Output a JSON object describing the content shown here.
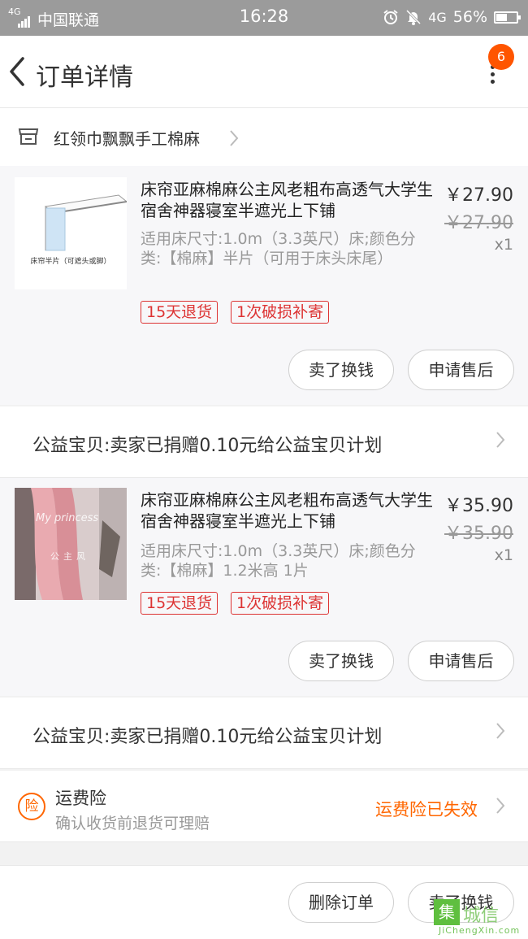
{
  "statusbar": {
    "network": "4G",
    "carrier": "中国联通",
    "time": "16:28",
    "net_type": "4G",
    "battery": "56%",
    "battery_level": 0.56,
    "icons": [
      "alarm-icon",
      "mute-bell-icon",
      "battery-icon"
    ]
  },
  "navbar": {
    "title": "订单详情",
    "badge_count": "6"
  },
  "shop": {
    "name": "红领巾飘飘手工棉麻"
  },
  "items": [
    {
      "title": "床帘亚麻棉麻公主风老粗布高透气大学生宿舍神器寝室半遮光上下铺",
      "sku": "适用床尺寸:1.0m（3.3英尺）床;颜色分类:【棉麻】半片（可用于床头床尾）",
      "price": "￥27.90",
      "original_price": "￥27.90",
      "qty": "x1",
      "thumb_caption": "床帘半片（可遮头或脚）",
      "tags": [
        "15天退货",
        "1次破损补寄"
      ],
      "buttons": [
        "卖了换钱",
        "申请售后"
      ]
    },
    {
      "title": "床帘亚麻棉麻公主风老粗布高透气大学生宿舍神器寝室半遮光上下铺",
      "sku": "适用床尺寸:1.0m（3.3英尺）床;颜色分类:【棉麻】1.2米高 1片",
      "price": "￥35.90",
      "original_price": "￥35.90",
      "qty": "x1",
      "thumb_caption": "My princess",
      "thumb_caption2": "公主风",
      "tags": [
        "15天退货",
        "1次破损补寄"
      ],
      "buttons": [
        "卖了换钱",
        "申请售后"
      ]
    }
  ],
  "charity": {
    "text": "公益宝贝:卖家已捐赠0.10元给公益宝贝计划"
  },
  "insurance": {
    "icon_char": "险",
    "title": "运费险",
    "subtitle": "确认收货前退货可理赔",
    "status": "运费险已失效"
  },
  "bottom": {
    "buttons": [
      "删除订单",
      "卖了换钱"
    ]
  },
  "watermark": {
    "glyph": "集",
    "name": "城信",
    "sub": "JiChengXin.com"
  },
  "colors": {
    "accent": "#ff6600",
    "badge": "#ff5500",
    "tag": "#dd3333",
    "statusbar": "#9b9b9b"
  }
}
